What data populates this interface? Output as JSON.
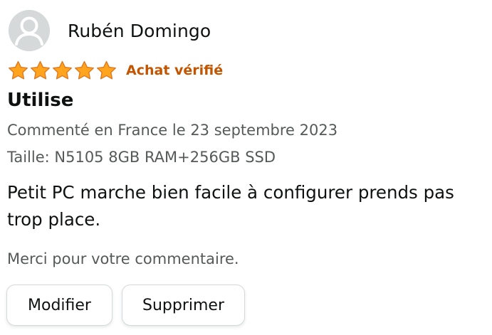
{
  "reviewer": {
    "name": "Rubén Domingo",
    "avatar_icon": "default-user-icon"
  },
  "rating": {
    "stars": 5,
    "max_stars": 5,
    "star_color": "#ffa41c",
    "verified_label": "Achat vérifié",
    "verified_color": "#c45500"
  },
  "review": {
    "title": "Utilise",
    "date_line": "Commenté en France le 23 septembre 2023",
    "variant_line": "Taille: N5105 8GB RAM+256GB SSD",
    "body": "Petit PC marche bien facile à configurer prends pas trop place."
  },
  "footer": {
    "thanks_text": "Merci pour votre commentaire.",
    "edit_label": "Modifier",
    "delete_label": "Supprimer"
  }
}
